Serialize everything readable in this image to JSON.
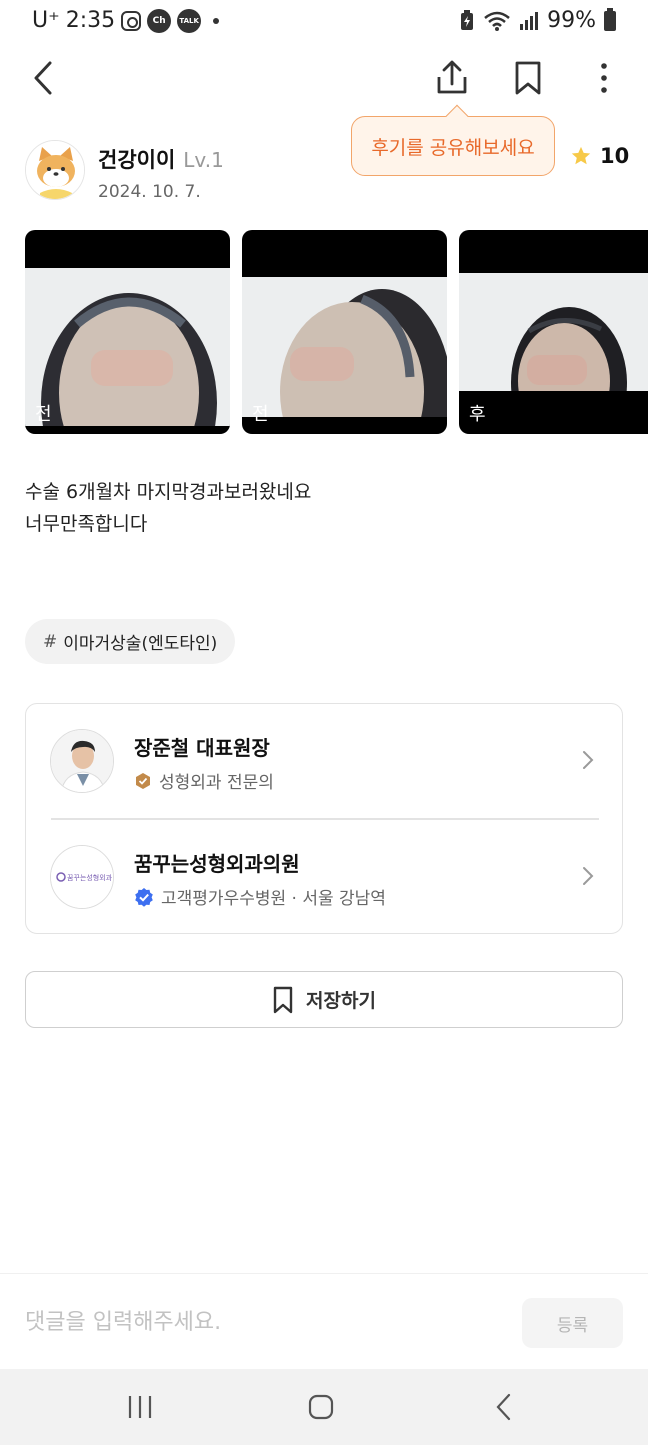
{
  "status_bar": {
    "carrier": "U⁺",
    "time": "2:35",
    "app_icon_ch": "Ch",
    "app_icon_talk": "TALK",
    "battery": "99%"
  },
  "header": {
    "back_icon": "chevron-left-icon",
    "share_icon": "share-icon",
    "bookmark_icon": "bookmark-icon",
    "more_icon": "more-vertical-icon"
  },
  "tooltip": {
    "text": "후기를 공유해보세요"
  },
  "author": {
    "name": "건강이이",
    "level": "Lv.1",
    "date": "2024. 10. 7."
  },
  "rating": {
    "value": "10",
    "icon": "star-icon",
    "color": "#f7c948"
  },
  "photos": [
    {
      "label": "전"
    },
    {
      "label": "전"
    },
    {
      "label": "후"
    }
  ],
  "review": {
    "line1": "수술 6개월차 마지막경과보러왔네요",
    "line2": "너무만족합니다"
  },
  "tag": {
    "hash": "#",
    "label": "이마거상술(엔도타인)"
  },
  "doctor": {
    "name": "장준철 대표원장",
    "badge_icon": "hexagon-badge-icon",
    "specialty": "성형외과 전문의"
  },
  "clinic": {
    "name": "꿈꾸는성형외과의원",
    "logo_text": "꿈꾸는성형외과",
    "badge_icon": "verified-badge-icon",
    "detail": "고객평가우수병원 · 서울 강남역"
  },
  "save_button": {
    "label": "저장하기",
    "icon": "bookmark-icon"
  },
  "comment": {
    "placeholder": "댓글을 입력해주세요.",
    "submit_label": "등록"
  },
  "colors": {
    "accent": "#e8692a",
    "tooltip_bg": "#fff4ea",
    "verified_blue": "#3d6ff0",
    "badge_brown": "#c28a4a"
  }
}
